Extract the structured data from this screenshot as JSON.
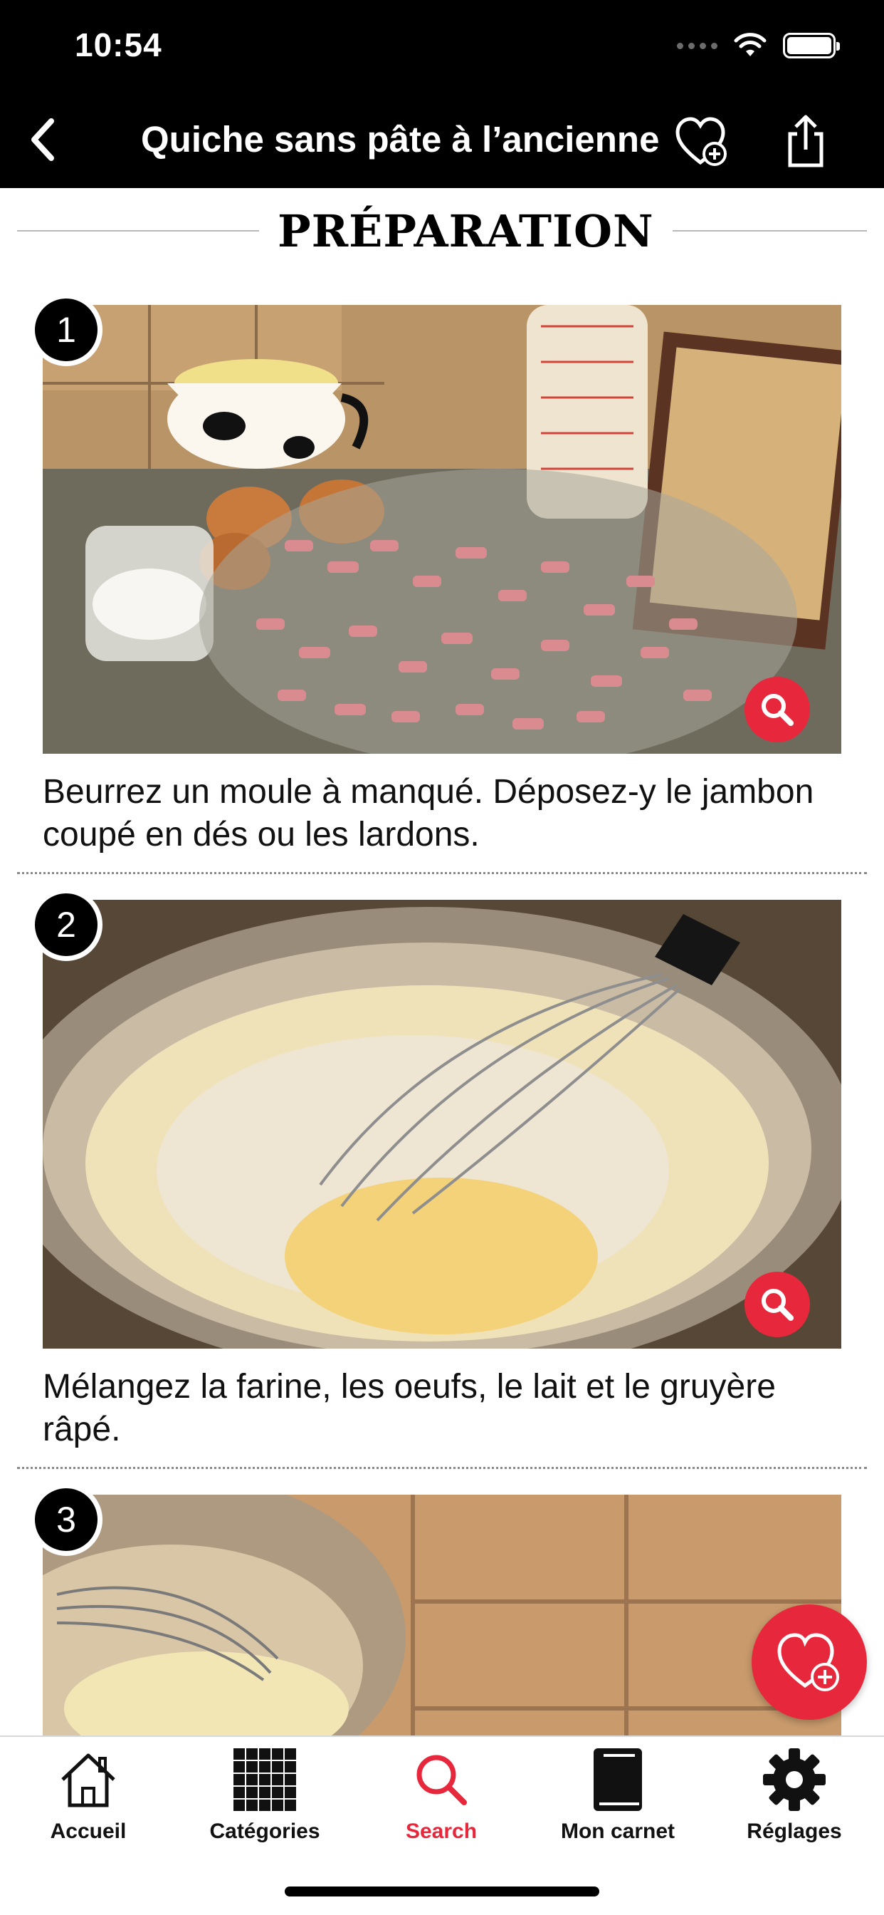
{
  "status_bar": {
    "time": "10:54"
  },
  "nav": {
    "title": "Quiche sans pâte à l’ancienne"
  },
  "section": {
    "title": "PRÉPARATION"
  },
  "steps": [
    {
      "number": "1",
      "text": "Beurrez un moule à manqué. Déposez-y le jambon coupé en dés ou les lardons."
    },
    {
      "number": "2",
      "text": "Mélangez la farine, les oeufs, le lait et le gruyère râpé."
    },
    {
      "number": "3",
      "text": ""
    }
  ],
  "tabs": [
    {
      "label": "Accueil",
      "icon": "home-icon",
      "active": false
    },
    {
      "label": "Catégories",
      "icon": "grid-icon",
      "active": false
    },
    {
      "label": "Search",
      "icon": "search-icon",
      "active": true
    },
    {
      "label": "Mon carnet",
      "icon": "notebook-icon",
      "active": false
    },
    {
      "label": "Réglages",
      "icon": "gear-icon",
      "active": false
    }
  ],
  "colors": {
    "accent": "#e7283c",
    "bar": "#000000",
    "text": "#111111"
  }
}
